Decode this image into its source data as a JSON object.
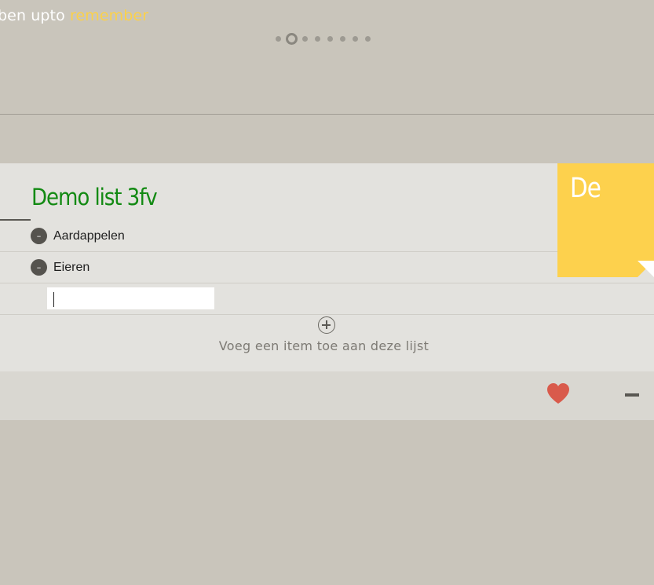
{
  "header": {
    "title_prefix": "ben upto",
    "title_accent": "remember",
    "pager": {
      "count": 8,
      "active_index": 1
    }
  },
  "list": {
    "title": "Demo list 3fv",
    "items": [
      {
        "label": "Aardappelen",
        "remove_symbol": "–"
      },
      {
        "label": "Eieren",
        "remove_symbol": "–"
      }
    ],
    "new_item_value": "",
    "add_label": "Voeg een item toe aan deze lijst"
  },
  "note": {
    "text": "De",
    "color": "#fdd14d"
  },
  "footer": {
    "heart_color": "#d95a4b",
    "icons": [
      "heart-icon",
      "minus-icon"
    ]
  },
  "colors": {
    "background": "#c9c5bb",
    "card": "#e3e2de",
    "title": "#138a13",
    "accent": "#fbd14a"
  }
}
